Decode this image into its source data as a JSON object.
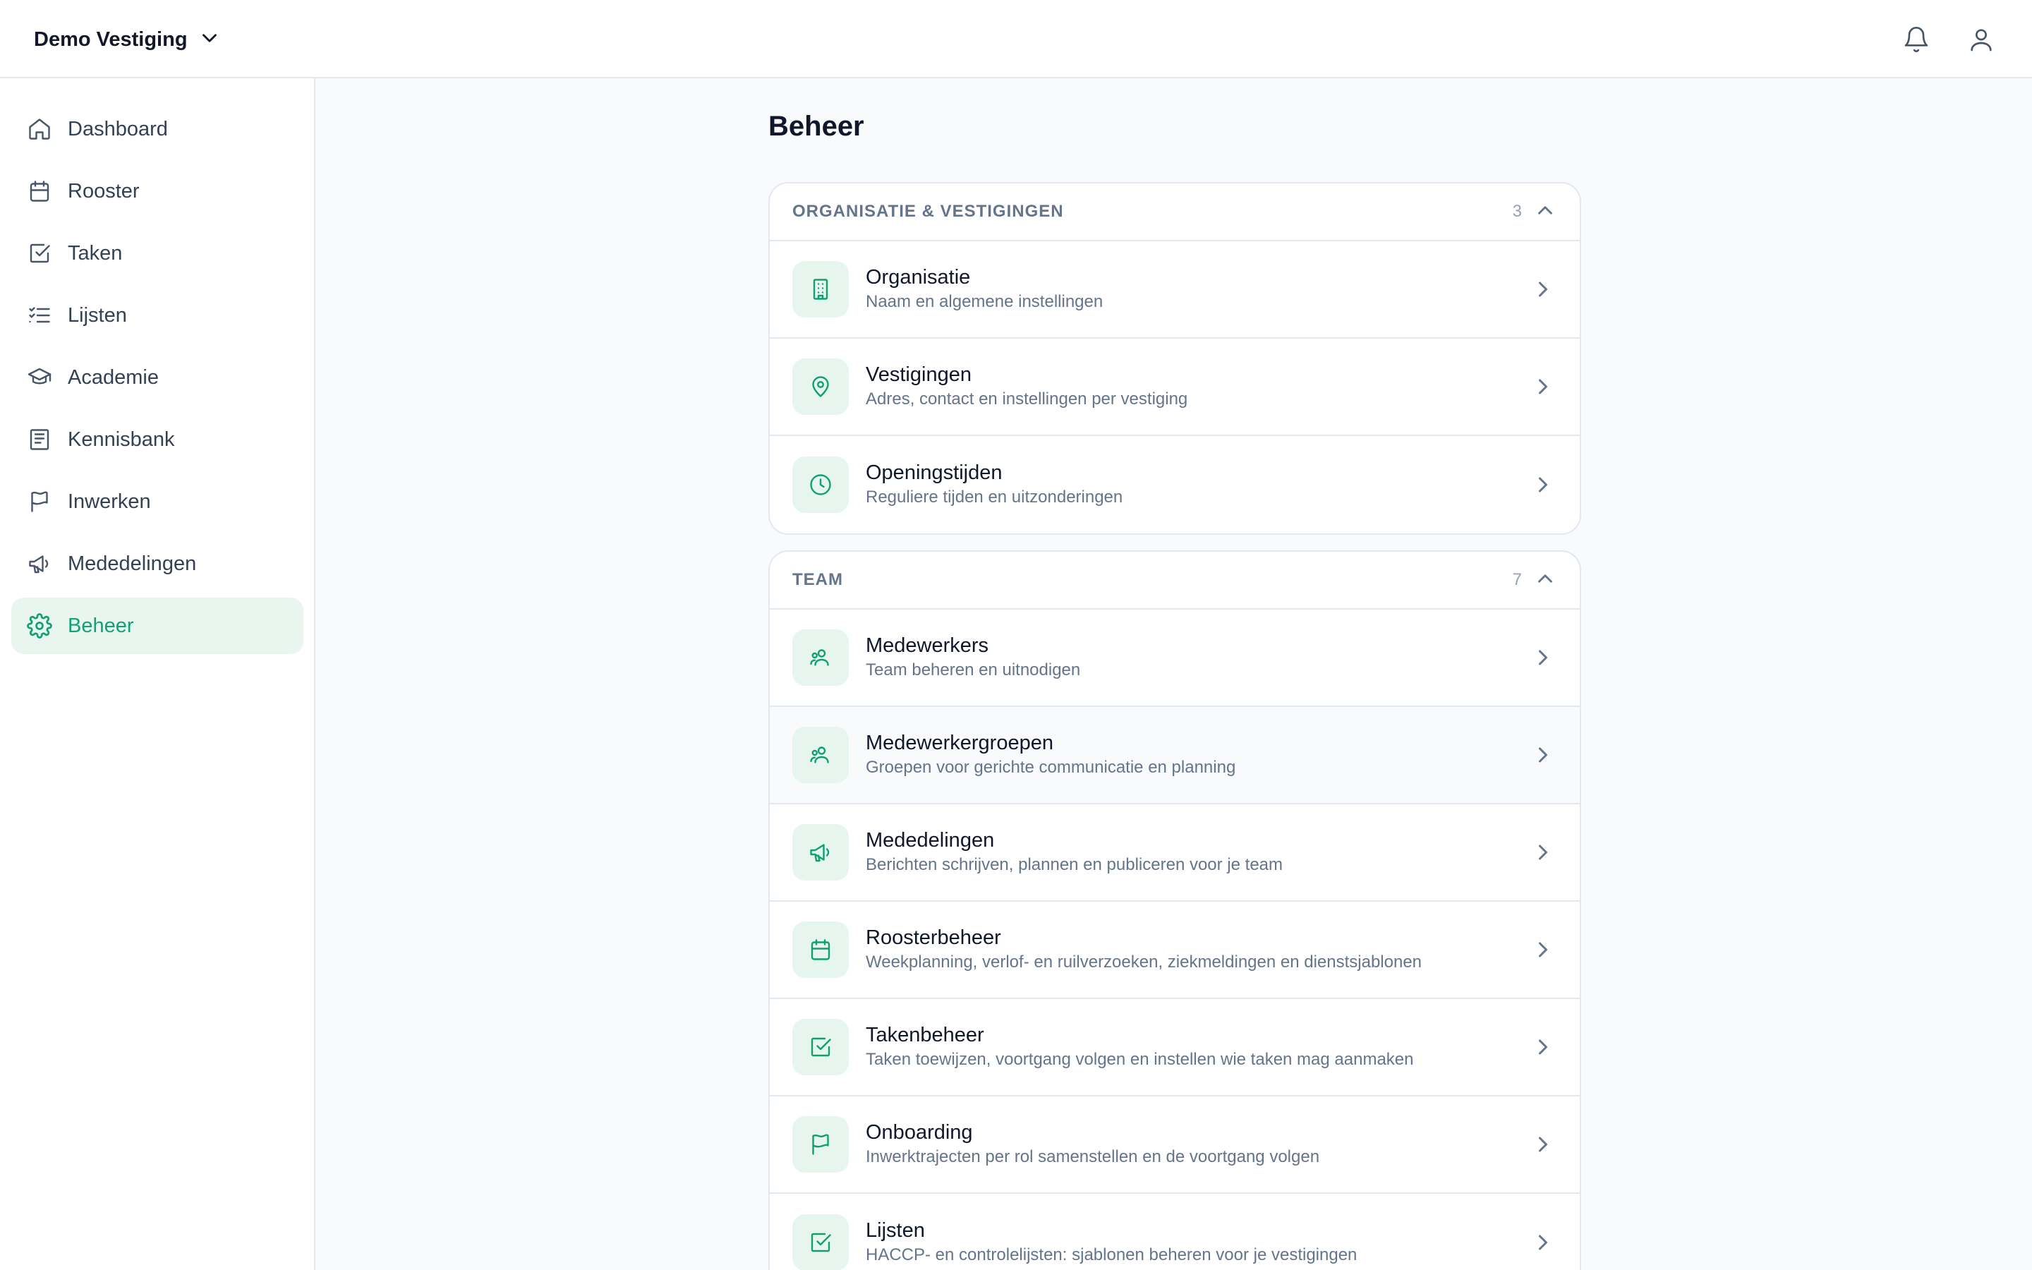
{
  "topbar": {
    "branch": "Demo Vestiging",
    "bell_icon": "bell-icon",
    "user_icon": "user-icon"
  },
  "sidebar": {
    "items": [
      {
        "label": "Dashboard",
        "icon": "home-icon",
        "active": false
      },
      {
        "label": "Rooster",
        "icon": "calendar-icon",
        "active": false
      },
      {
        "label": "Taken",
        "icon": "check-square-icon",
        "active": false
      },
      {
        "label": "Lijsten",
        "icon": "list-icon",
        "active": false
      },
      {
        "label": "Academie",
        "icon": "graduation-cap-icon",
        "active": false
      },
      {
        "label": "Kennisbank",
        "icon": "book-icon",
        "active": false
      },
      {
        "label": "Inwerken",
        "icon": "flag-icon",
        "active": false
      },
      {
        "label": "Mededelingen",
        "icon": "megaphone-icon",
        "active": false
      },
      {
        "label": "Beheer",
        "icon": "gear-icon",
        "active": true
      }
    ]
  },
  "main": {
    "title": "Beheer",
    "sections": [
      {
        "title": "ORGANISATIE & VESTIGINGEN",
        "count": "3",
        "rows": [
          {
            "title": "Organisatie",
            "desc": "Naam en algemene instellingen",
            "icon": "building-icon"
          },
          {
            "title": "Vestigingen",
            "desc": "Adres, contact en instellingen per vestiging",
            "icon": "map-pin-icon"
          },
          {
            "title": "Openingstijden",
            "desc": "Reguliere tijden en uitzonderingen",
            "icon": "clock-icon"
          }
        ]
      },
      {
        "title": "TEAM",
        "count": "7",
        "rows": [
          {
            "title": "Medewerkers",
            "desc": "Team beheren en uitnodigen",
            "icon": "users-icon"
          },
          {
            "title": "Medewerkergroepen",
            "desc": "Groepen voor gerichte communicatie en planning",
            "icon": "users-icon"
          },
          {
            "title": "Mededelingen",
            "desc": "Berichten schrijven, plannen en publiceren voor je team",
            "icon": "megaphone-icon"
          },
          {
            "title": "Roosterbeheer",
            "desc": "Weekplanning, verlof- en ruilverzoeken, ziekmeldingen en dienstsjablonen",
            "icon": "calendar-icon"
          },
          {
            "title": "Takenbeheer",
            "desc": "Taken toewijzen, voortgang volgen en instellen wie taken mag aanmaken",
            "icon": "check-square-icon"
          },
          {
            "title": "Onboarding",
            "desc": "Inwerktrajecten per rol samenstellen en de voortgang volgen",
            "icon": "flag-icon"
          },
          {
            "title": "Lijsten",
            "desc": "HACCP- en controlelijsten: sjablonen beheren voor je vestigingen",
            "icon": "check-square-icon"
          }
        ]
      }
    ]
  },
  "colors": {
    "accent": "#10a070",
    "accent_bg": "#e6f6ee",
    "sidebar_active_bg": "#e8f6ef"
  }
}
